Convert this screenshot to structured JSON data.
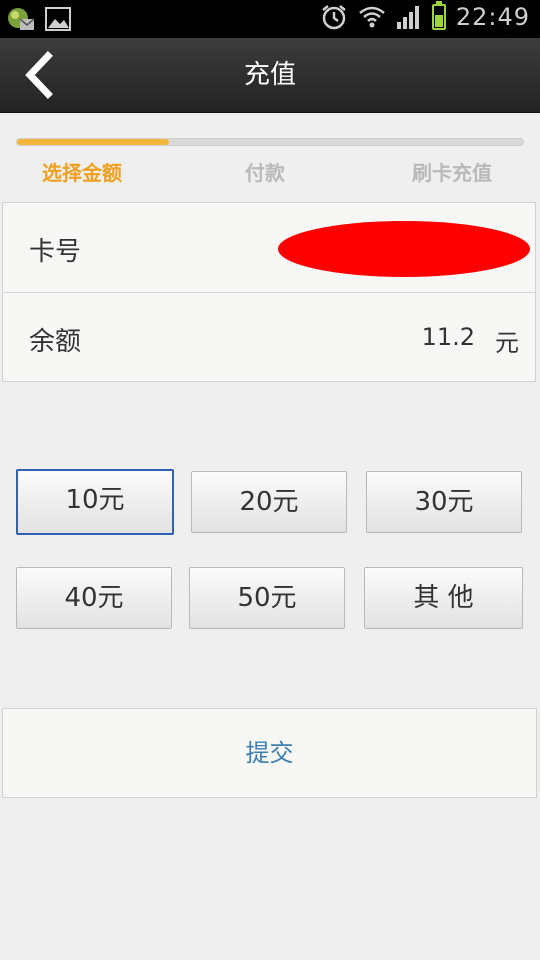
{
  "status_bar": {
    "time": "22:49",
    "icons": [
      "notification-app-icon",
      "gallery-icon",
      "alarm-icon",
      "wifi-icon",
      "signal-icon",
      "battery-icon"
    ],
    "battery_level": 0.55
  },
  "header": {
    "title": "充值",
    "back_icon": "chevron-left-icon"
  },
  "steps": {
    "progress": 0.3,
    "items": [
      "选择金额",
      "付款",
      "刷卡充值"
    ],
    "active_index": 0,
    "active_color": "#f0a020",
    "inactive_color": "#b9b9b9"
  },
  "card": {
    "card_number_label": "卡号",
    "balance_label": "余额",
    "balance_value": "11.2",
    "balance_unit": "元"
  },
  "amounts": {
    "options": [
      "10元",
      "20元",
      "30元",
      "40元",
      "50元",
      "其 他"
    ],
    "selected_index": 0,
    "selected_border_color": "#2f62b6"
  },
  "submit": {
    "label": "提交",
    "color": "#3b7fb1"
  }
}
